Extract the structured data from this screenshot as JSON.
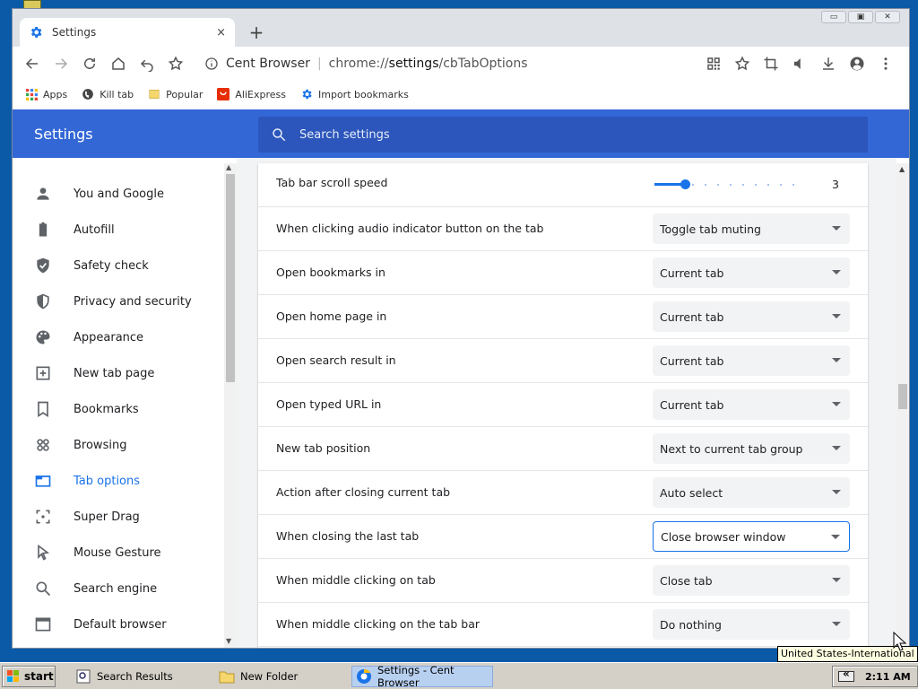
{
  "browser": {
    "tab_title": "Settings",
    "tab_close": "×",
    "new_tab": "+",
    "win_minimize": "▭",
    "win_restore": "▣",
    "win_close": "✕",
    "site_name": "Cent Browser",
    "url_prefix": "chrome://",
    "url_host": "settings",
    "url_path": "/cbTabOptions"
  },
  "bookmarks": [
    {
      "label": "Apps",
      "icon": "apps-grid-icon"
    },
    {
      "label": "Kill tab",
      "icon": "globe-icon"
    },
    {
      "label": "Popular",
      "icon": "folder-icon"
    },
    {
      "label": "AliExpress",
      "icon": "aliexpress-icon"
    },
    {
      "label": "Import bookmarks",
      "icon": "gear-icon"
    }
  ],
  "settings": {
    "title": "Settings",
    "search_placeholder": "Search settings"
  },
  "sidebar": {
    "items": [
      {
        "label": "You and Google",
        "icon": "person-icon"
      },
      {
        "label": "Autofill",
        "icon": "clipboard-icon"
      },
      {
        "label": "Safety check",
        "icon": "shield-check-icon"
      },
      {
        "label": "Privacy and security",
        "icon": "shield-half-icon"
      },
      {
        "label": "Appearance",
        "icon": "palette-icon"
      },
      {
        "label": "New tab page",
        "icon": "new-tab-icon"
      },
      {
        "label": "Bookmarks",
        "icon": "bookmark-icon"
      },
      {
        "label": "Browsing",
        "icon": "browsing-icon"
      },
      {
        "label": "Tab options",
        "icon": "tab-icon"
      },
      {
        "label": "Super Drag",
        "icon": "drag-icon"
      },
      {
        "label": "Mouse Gesture",
        "icon": "pointer-icon"
      },
      {
        "label": "Search engine",
        "icon": "search-icon"
      },
      {
        "label": "Default browser",
        "icon": "browser-window-icon"
      }
    ],
    "active_index": 8
  },
  "rows": {
    "scroll_speed": {
      "label": "Tab bar scroll speed",
      "value": "3",
      "level": 0.2
    },
    "items": [
      {
        "label": "When clicking audio indicator button on the tab",
        "value": "Toggle tab muting"
      },
      {
        "label": "Open bookmarks in",
        "value": "Current tab"
      },
      {
        "label": "Open home page in",
        "value": "Current tab"
      },
      {
        "label": "Open search result in",
        "value": "Current tab"
      },
      {
        "label": "Open typed URL in",
        "value": "Current tab"
      },
      {
        "label": "New tab position",
        "value": "Next to current tab group"
      },
      {
        "label": "Action after closing current tab",
        "value": "Auto select"
      },
      {
        "label": "When closing the last tab",
        "value": "Close browser window"
      },
      {
        "label": "When middle clicking on tab",
        "value": "Close tab"
      },
      {
        "label": "When middle clicking on the tab bar",
        "value": "Do nothing"
      }
    ],
    "focused_index": 7
  },
  "taskbar": {
    "start": "start",
    "tasks": [
      {
        "label": "Search Results"
      },
      {
        "label": "New Folder"
      },
      {
        "label": "Settings - Cent Browser"
      }
    ],
    "tray_expand": "«",
    "clock": "2:11 AM",
    "tooltip": "United States-International"
  },
  "colors": {
    "header": "#3367d6",
    "accent": "#1a73e8",
    "desktop": "#0a5aa8"
  }
}
